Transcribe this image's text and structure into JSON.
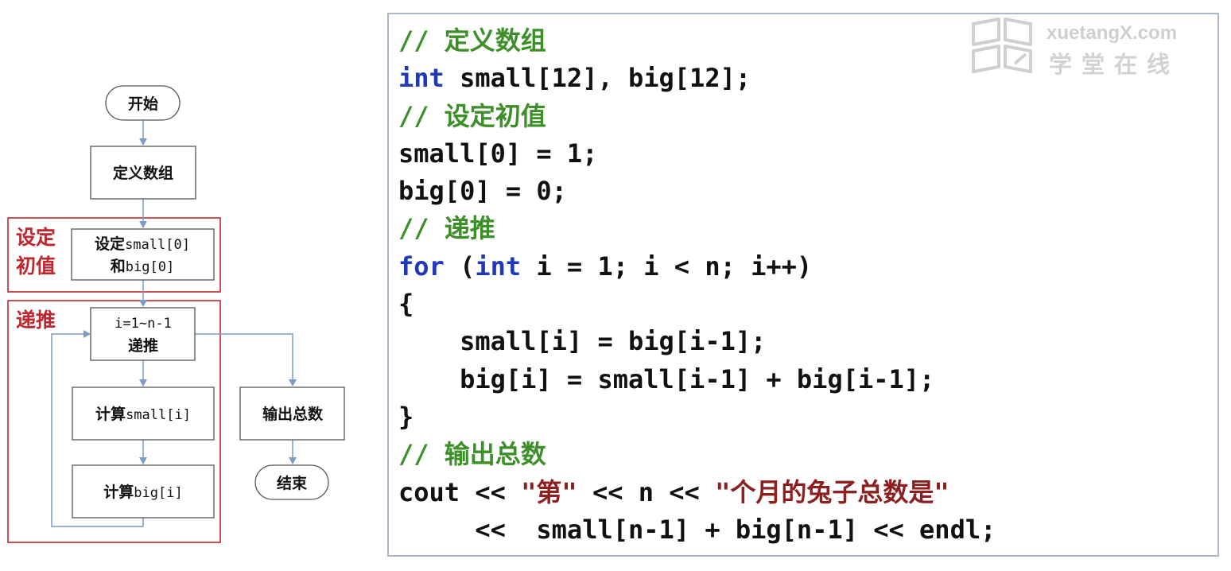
{
  "flowchart": {
    "start": "开始",
    "define_arrays": "定义数组",
    "init_label_a": "设定",
    "init_code_a": "small[0]",
    "init_label_b": "和",
    "init_code_b": "big[0]",
    "loop_range": "i=1~n-1",
    "loop_label": "递推",
    "calc_label_1": "计算",
    "calc_code_1": "small[i]",
    "calc_label_2": "计算",
    "calc_code_2": "big[i]",
    "output": "输出总数",
    "end": "结束",
    "group_init_line1": "设定",
    "group_init_line2": "初值",
    "group_recur": "递推"
  },
  "code": {
    "lines": [
      [
        {
          "t": "// 定义数组",
          "c": "cm"
        }
      ],
      [
        {
          "t": "int",
          "c": "kw"
        },
        {
          "t": " small[12], big[12];"
        }
      ],
      [
        {
          "t": "// 设定初值",
          "c": "cm"
        }
      ],
      [
        {
          "t": "small[0] = 1;"
        }
      ],
      [
        {
          "t": "big[0] = 0;"
        }
      ],
      [
        {
          "t": "// 递推",
          "c": "cm"
        }
      ],
      [
        {
          "t": "for",
          "c": "kw"
        },
        {
          "t": " ("
        },
        {
          "t": "int",
          "c": "kw"
        },
        {
          "t": " i = 1; i < n; i++)"
        }
      ],
      [
        {
          "t": "{"
        }
      ],
      [
        {
          "t": "    small[i] = big[i-1];"
        }
      ],
      [
        {
          "t": "    big[i] = small[i-1] + big[i-1];"
        }
      ],
      [
        {
          "t": "}"
        }
      ],
      [
        {
          "t": "// 输出总数",
          "c": "cm"
        }
      ],
      [
        {
          "t": "cout << "
        },
        {
          "t": "\"第\"",
          "c": "st"
        },
        {
          "t": " << n << "
        },
        {
          "t": "\"个月的兔子总数是\"",
          "c": "st"
        }
      ],
      [
        {
          "t": "     <<  small[n-1] + big[n-1] << endl;"
        }
      ]
    ]
  },
  "logo": {
    "text_en": "xuetangX.com",
    "text_cn": "学堂在线"
  },
  "colors": {
    "comment": "#3d8f2a",
    "keyword": "#1f39b8",
    "string": "#8c1f1f",
    "group_border": "#c0262d",
    "arrow": "#7a9cc6"
  }
}
